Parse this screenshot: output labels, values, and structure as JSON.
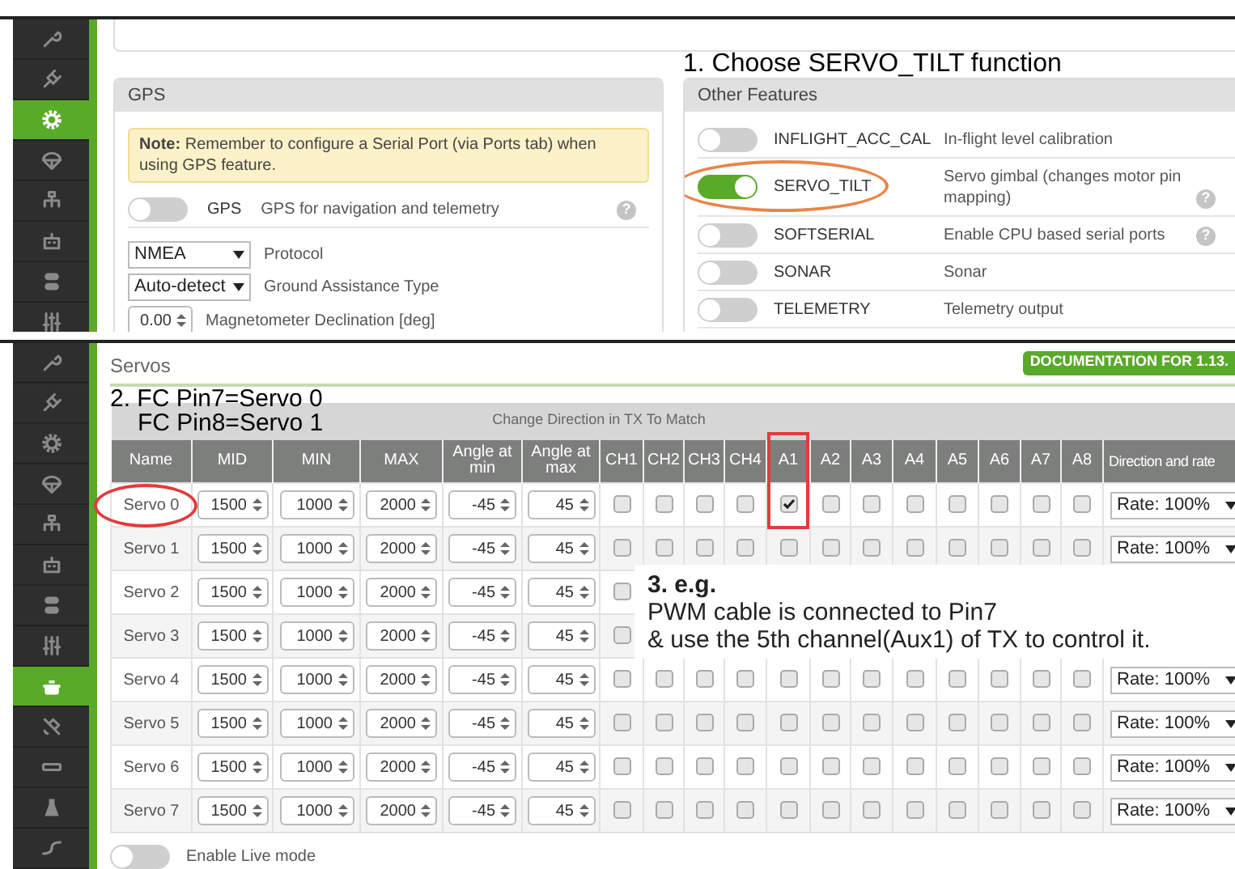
{
  "setup_panel": {
    "sidebar": [
      {
        "kind": "wrench",
        "selected": false
      },
      {
        "kind": "plug",
        "selected": false
      },
      {
        "kind": "gear",
        "selected": true
      },
      {
        "kind": "parachute",
        "selected": false
      },
      {
        "kind": "network",
        "selected": false
      },
      {
        "kind": "robot",
        "selected": false
      },
      {
        "kind": "toggle",
        "selected": false
      },
      {
        "kind": "sliders",
        "selected": false
      }
    ],
    "gps_card": {
      "title": "GPS",
      "note": "**Note:** Remember to configure a Serial Port (via Ports tab) when using GPS feature.",
      "gps_toggle": {
        "label": "GPS",
        "description": "GPS for navigation and telemetry",
        "on": false,
        "help": "?"
      },
      "protocol": {
        "value": "NMEA",
        "label": "Protocol"
      },
      "ground_assistance": {
        "value": "Auto-detect",
        "label": "Ground Assistance Type"
      },
      "declination": {
        "value": "0.00",
        "label": "Magnetometer Declination [deg]"
      }
    },
    "annotation": "1. Choose SERVO_TILT function",
    "other_features": {
      "title": "Other Features",
      "features": [
        {
          "name": "INFLIGHT_ACC_CAL",
          "description": "In-flight level calibration",
          "on": false,
          "circled": false
        },
        {
          "name": "SERVO_TILT",
          "description": "Servo gimbal (changes motor pin mapping)",
          "on": true,
          "circled": true,
          "help": "?"
        },
        {
          "name": "SOFTSERIAL",
          "description": "Enable CPU based serial ports",
          "on": false,
          "circled": false,
          "help": "?"
        },
        {
          "name": "SONAR",
          "description": "Sonar",
          "on": false,
          "circled": false
        },
        {
          "name": "TELEMETRY",
          "description": "Telemetry output",
          "on": false,
          "circled": false
        }
      ]
    }
  },
  "servos_panel": {
    "sidebar": [
      {
        "kind": "wrench",
        "selected": false
      },
      {
        "kind": "plug",
        "selected": false
      },
      {
        "kind": "gear",
        "selected": false
      },
      {
        "kind": "parachute",
        "selected": false
      },
      {
        "kind": "network",
        "selected": false
      },
      {
        "kind": "robot",
        "selected": false
      },
      {
        "kind": "toggle",
        "selected": false
      },
      {
        "kind": "sliders",
        "selected": false
      },
      {
        "kind": "pot",
        "selected": true
      },
      {
        "kind": "satellite",
        "selected": false
      },
      {
        "kind": "rectangle",
        "selected": false
      },
      {
        "kind": "flask",
        "selected": false
      },
      {
        "kind": "cable",
        "selected": false
      }
    ],
    "title": "Servos",
    "documentation_button": "DOCUMENTATION FOR 1.13.",
    "annotation_lines": [
      "2. FC Pin7=Servo 0",
      "FC Pin8=Servo 1"
    ],
    "table": {
      "group_header": "Change Direction in TX To Match",
      "columns": [
        {
          "label": "Name",
          "highlighted": false
        },
        {
          "label": "MID",
          "highlighted": false
        },
        {
          "label": "MIN",
          "highlighted": false
        },
        {
          "label": "MAX",
          "highlighted": false
        },
        {
          "label": "Angle at min",
          "highlighted": false
        },
        {
          "label": "Angle at max",
          "highlighted": false
        },
        {
          "label": "CH1",
          "highlighted": false
        },
        {
          "label": "CH2",
          "highlighted": false
        },
        {
          "label": "CH3",
          "highlighted": false
        },
        {
          "label": "CH4",
          "highlighted": false
        },
        {
          "label": "A1",
          "highlighted": true
        },
        {
          "label": "A2",
          "highlighted": false
        },
        {
          "label": "A3",
          "highlighted": false
        },
        {
          "label": "A4",
          "highlighted": false
        },
        {
          "label": "A5",
          "highlighted": false
        },
        {
          "label": "A6",
          "highlighted": false
        },
        {
          "label": "A7",
          "highlighted": false
        },
        {
          "label": "A8",
          "highlighted": false
        },
        {
          "label": "Direction and rate",
          "highlighted": false
        }
      ],
      "rows": [
        {
          "name": "Servo 0",
          "circled": true,
          "mid": "1500",
          "min": "1000",
          "max": "2000",
          "angle_min": "-45",
          "angle_max": "45",
          "channels": [
            false,
            false,
            false,
            false,
            true,
            false,
            false,
            false,
            false,
            false,
            false,
            false
          ],
          "rate": "Rate: 100%"
        },
        {
          "name": "Servo 1",
          "circled": false,
          "mid": "1500",
          "min": "1000",
          "max": "2000",
          "angle_min": "-45",
          "angle_max": "45",
          "channels": [
            false,
            false,
            false,
            false,
            false,
            false,
            false,
            false,
            false,
            false,
            false,
            false
          ],
          "rate": "Rate: 100%"
        },
        {
          "name": "Servo 2",
          "circled": false,
          "mid": "1500",
          "min": "1000",
          "max": "2000",
          "angle_min": "-45",
          "angle_max": "45",
          "channels": [
            false
          ]
        },
        {
          "name": "Servo 3",
          "circled": false,
          "mid": "1500",
          "min": "1000",
          "max": "2000",
          "angle_min": "-45",
          "angle_max": "45",
          "channels": [
            false
          ]
        },
        {
          "name": "Servo 4",
          "circled": false,
          "mid": "1500",
          "min": "1000",
          "max": "2000",
          "angle_min": "-45",
          "angle_max": "45",
          "channels": [
            false,
            false,
            false,
            false,
            false,
            false,
            false,
            false,
            false,
            false,
            false,
            false
          ],
          "rate": "Rate: 100%"
        },
        {
          "name": "Servo 5",
          "circled": false,
          "mid": "1500",
          "min": "1000",
          "max": "2000",
          "angle_min": "-45",
          "angle_max": "45",
          "channels": [
            false,
            false,
            false,
            false,
            false,
            false,
            false,
            false,
            false,
            false,
            false,
            false
          ],
          "rate": "Rate: 100%"
        },
        {
          "name": "Servo 6",
          "circled": false,
          "mid": "1500",
          "min": "1000",
          "max": "2000",
          "angle_min": "-45",
          "angle_max": "45",
          "channels": [
            false,
            false,
            false,
            false,
            false,
            false,
            false,
            false,
            false,
            false,
            false,
            false
          ],
          "rate": "Rate: 100%"
        },
        {
          "name": "Servo 7",
          "circled": false,
          "mid": "1500",
          "min": "1000",
          "max": "2000",
          "angle_min": "-45",
          "angle_max": "45",
          "channels": [
            false,
            false,
            false,
            false,
            false,
            false,
            false,
            false,
            false,
            false,
            false,
            false
          ],
          "rate": "Rate: 100%"
        }
      ]
    },
    "annotation_note": {
      "title": "3. e.g.",
      "lines": [
        "PWM cable is connected to Pin7",
        "& use the 5th channel(Aux1) of TX to control it."
      ]
    },
    "live_mode": {
      "label": "Enable Live mode",
      "on": false
    }
  }
}
